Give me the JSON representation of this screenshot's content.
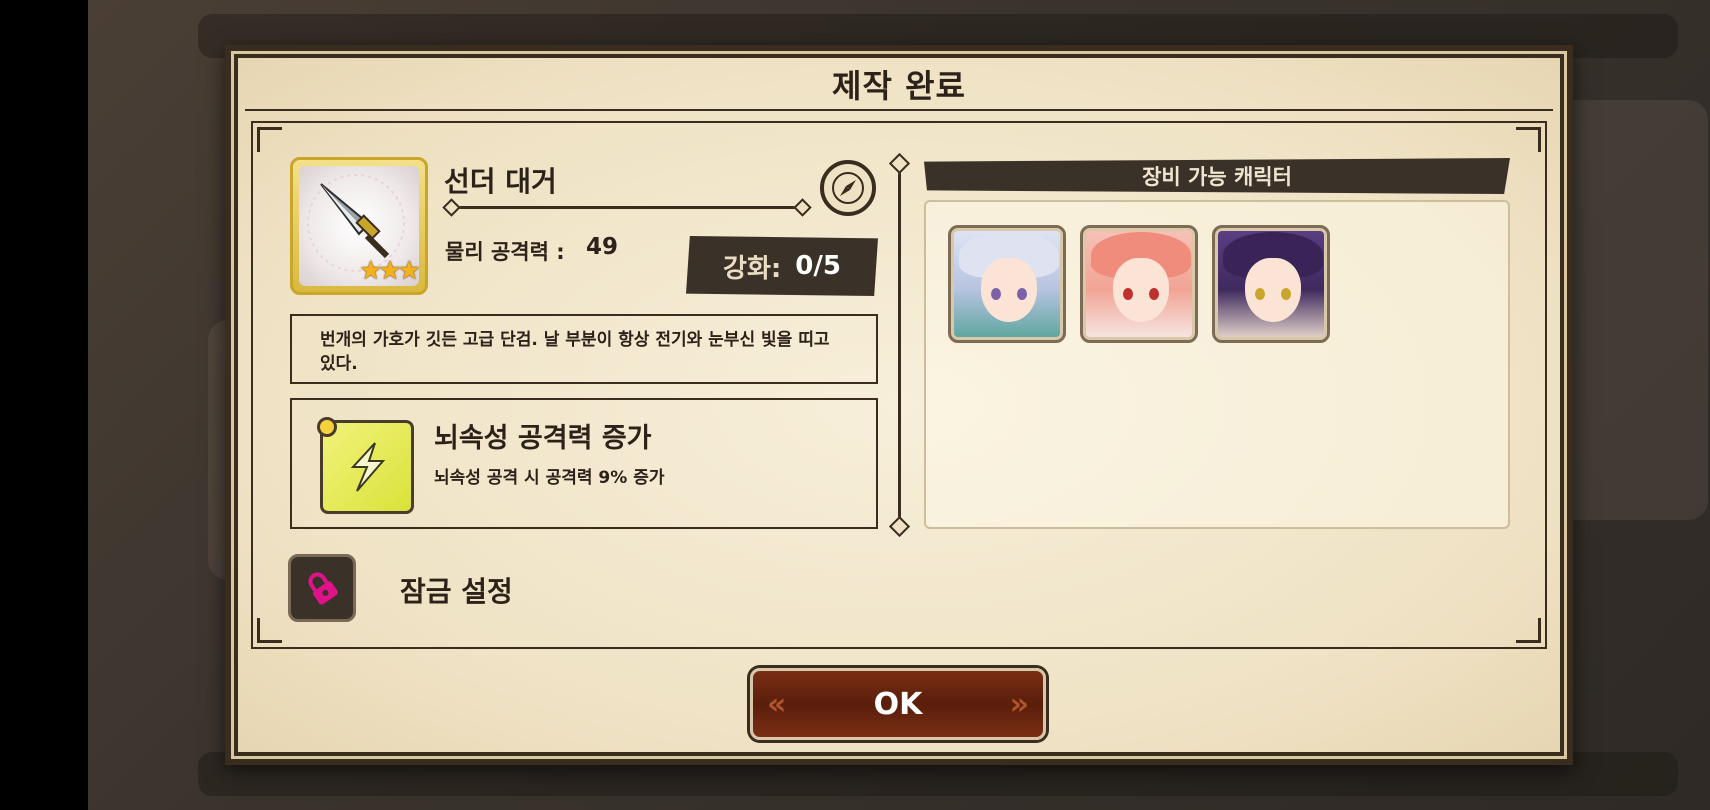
{
  "dialog": {
    "title": "제작 완료",
    "ok_label": "OK"
  },
  "item": {
    "name": "선더 대거",
    "stars": "★★★",
    "star_count": 3,
    "stat_label": "물리 공격력 :",
    "stat_value": "49",
    "enhance_label": "강화:",
    "enhance_value": "0/5",
    "description": "번개의 가호가 깃든 고급 단검. 날 부분이 항상 전기와 눈부신 빛을 띠고 있다."
  },
  "skill": {
    "name": "뇌속성 공격력 증가",
    "description": "뇌속성 공격 시 공격력 9% 증가",
    "icon": "lightning-icon"
  },
  "lock": {
    "label": "잠금 설정",
    "icon": "lock-icon"
  },
  "characters": {
    "header": "장비 가능 캐릭터",
    "portraits": [
      {
        "id": "char-1",
        "hair": "silver"
      },
      {
        "id": "char-2",
        "hair": "pink"
      },
      {
        "id": "char-3",
        "hair": "purple"
      }
    ]
  },
  "colors": {
    "frame": "#3a2d1f",
    "parchment": "#efe2c4",
    "ok_button": "#6a2610",
    "gold_frame": "#c9a52a"
  }
}
